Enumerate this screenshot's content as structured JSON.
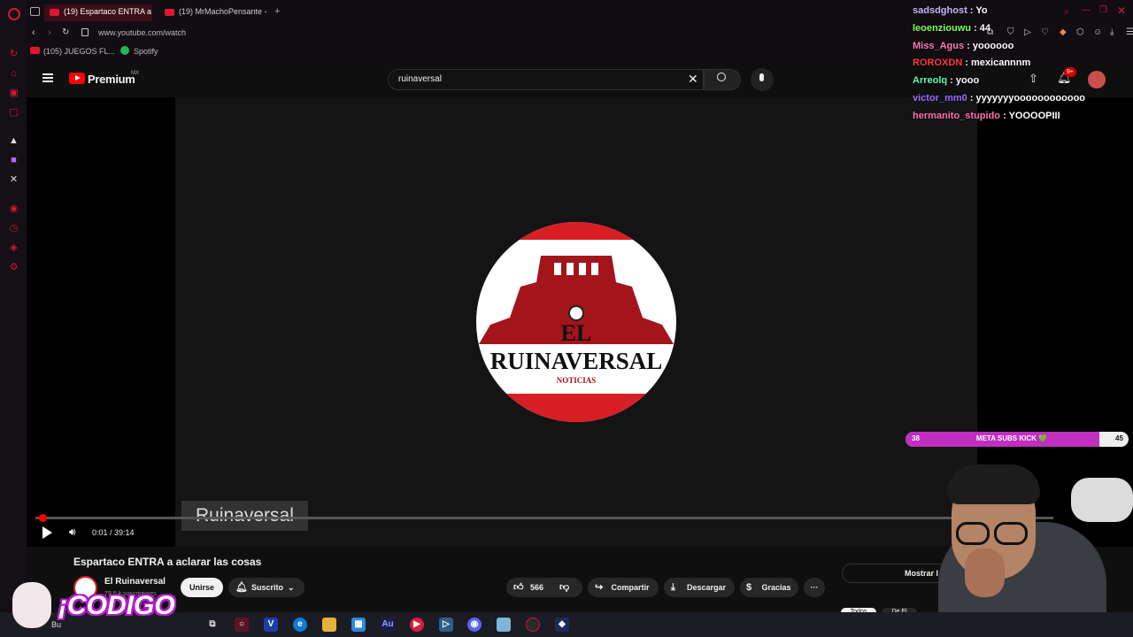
{
  "browser": {
    "tabs": [
      {
        "label": "(19) Espartaco ENTRA a a"
      },
      {
        "label": "(19) MrMachoPensante -"
      }
    ],
    "new_tab": "+",
    "url": "www.youtube.com/watch",
    "bookmarks": [
      {
        "label": "(105) JUEGOS FL..."
      },
      {
        "label": "Spotify"
      }
    ]
  },
  "youtube": {
    "logo_text": "Premium",
    "region": "MX",
    "search_value": "ruinaversal",
    "notification_badge": "9+"
  },
  "player": {
    "logo": {
      "line1": "EL",
      "line2": "RUINAVERSAL",
      "line3": "NOTICIAS"
    },
    "watermark": "Ruinaversal",
    "time": "0:01 / 39:14",
    "progress": 0.0004
  },
  "video": {
    "title": "Espartaco ENTRA a aclarar las cosas",
    "channel_name": "El Ruinaversal",
    "subscribers": "79.5 k suscriptores",
    "join_label": "Unirse",
    "subscribed_label": "Suscrito",
    "likes": "566",
    "share_label": "Compartir",
    "download_label": "Descargar",
    "thanks_label": "Gracias",
    "show_label": "Mostrar l",
    "chip1": "Todos",
    "chip2": "De El"
  },
  "chat": [
    {
      "user": "sadsdghost",
      "msg": "Yo",
      "color": "#c9b5ff"
    },
    {
      "user": "leoenziouwu",
      "msg": "44",
      "color": "#7dff5c"
    },
    {
      "user": "Miss_Agus",
      "msg": "yoooooo",
      "color": "#ff7ab8"
    },
    {
      "user": "ROROXDN",
      "msg": "mexicannnm",
      "color": "#ff3b3b"
    },
    {
      "user": "Arreolq",
      "msg": "yooo",
      "color": "#5cffb0"
    },
    {
      "user": "victor_mm0",
      "msg": "yyyyyyyoooooooooooo",
      "color": "#9a6bff"
    },
    {
      "user": "hermanito_stupido",
      "msg": "YOOOOPIII",
      "color": "#ff6fae"
    }
  ],
  "sub_goal": {
    "start": "38",
    "label": "META SUBS KICK 💚",
    "end": "45",
    "progress": 0.87
  },
  "overlay_code": "¡CODIGO",
  "taskbar_search": "Bu"
}
